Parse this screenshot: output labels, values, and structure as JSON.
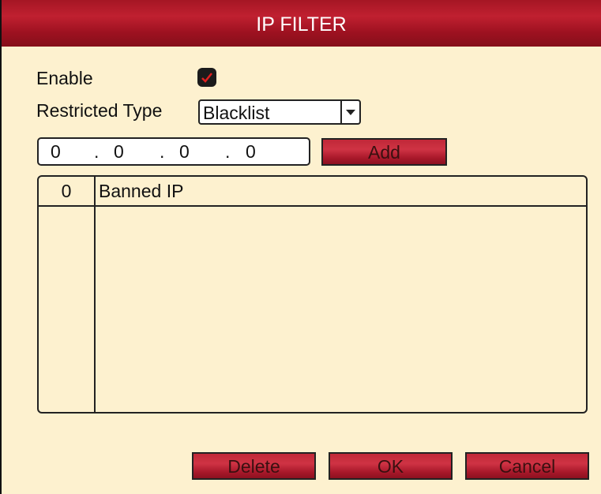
{
  "dialog": {
    "title": "IP FILTER"
  },
  "enable": {
    "label": "Enable",
    "checked": true
  },
  "restricted_type": {
    "label": "Restricted Type",
    "value": "Blacklist"
  },
  "ip_address": {
    "octets": [
      "0",
      "0",
      "0",
      "0"
    ]
  },
  "buttons": {
    "add": "Add",
    "delete": "Delete",
    "ok": "OK",
    "cancel": "Cancel"
  },
  "table": {
    "columns": [
      "0",
      "Banned IP"
    ],
    "rows": []
  },
  "colors": {
    "titlebar": "#a51624",
    "panel": "#fdf1cf",
    "check": "#e02020"
  }
}
